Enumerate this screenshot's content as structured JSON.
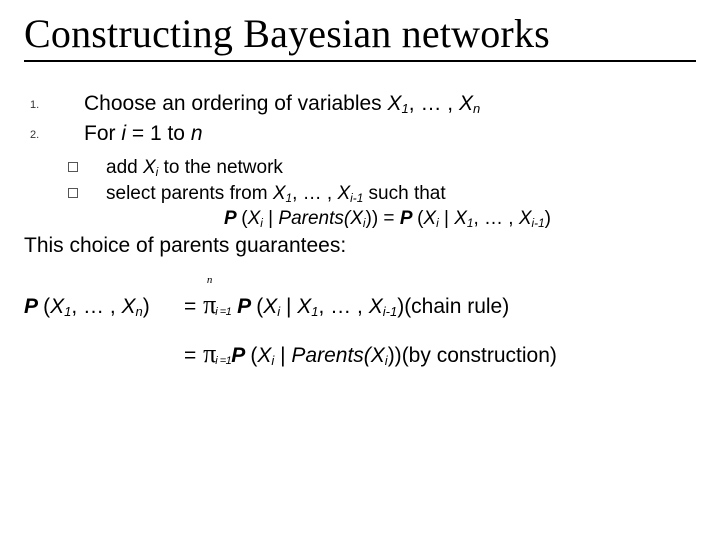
{
  "title": "Constructing Bayesian networks",
  "list": {
    "n1": "1.",
    "t1_pre": "Choose an ordering of variables ",
    "t1_vars": "X₁, … , Xₙ",
    "n2": "2.",
    "t2_pre": "For ",
    "t2_i": "i",
    "t2_post": " = 1 to ",
    "t2_n": "n"
  },
  "sub": {
    "a_pre": "add ",
    "a_xi": "Xᵢ",
    "a_post": " to the network",
    "b_pre": "select parents from ",
    "b_vars": "X₁, … , Xᵢ₋₁",
    "b_post": " such that"
  },
  "cond": {
    "lhs_p": "P ",
    "lhs_open": "(",
    "lhs_xi": "Xᵢ",
    "lhs_bar": " | ",
    "lhs_par": "Parents(Xᵢ",
    "lhs_close": ")) = ",
    "rhs_p": "P ",
    "rhs_open": "(",
    "rhs_xi": "Xᵢ",
    "rhs_bar": " | ",
    "rhs_vars": "X₁, … , Xᵢ₋₁",
    "rhs_close": ")"
  },
  "para": "This choice of parents guarantees:",
  "eq": {
    "lhs_p": "P ",
    "lhs_vars": "(X₁, … , Xₙ)",
    "eq": "= ",
    "pi": "π",
    "pi_n": "n",
    "pi_sub": "i =1",
    "r1_p": " P ",
    "r1_open": "(",
    "r1_xi": "Xᵢ",
    "r1_bar": " | ",
    "r1_vars": "X₁, … , Xᵢ₋₁",
    "r1_close": ")",
    "r1_note": "(chain rule)",
    "r2_p": "P ",
    "r2_open": "(",
    "r2_xi": "Xᵢ",
    "r2_bar": " | ",
    "r2_par": "Parents(Xᵢ",
    "r2_close": "))",
    "r2_note": "(by construction)"
  }
}
